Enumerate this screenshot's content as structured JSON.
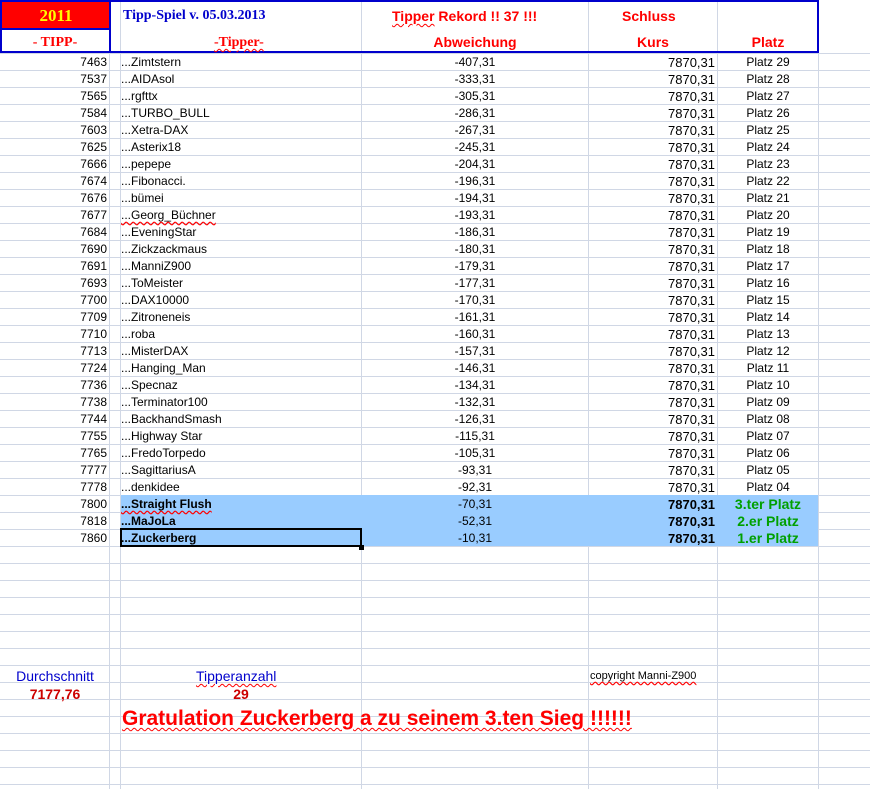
{
  "header": {
    "year": "2011",
    "spiel_label": "Tipp-Spiel v. 05.03.2013",
    "rekord_prefix": "Tipper",
    "rekord_rest": " Rekord !!  37  !!!",
    "schluss": "Schluss",
    "col_tipp": "- TIPP-",
    "col_tipper": "-Tipper-",
    "col_abweichung": "Abweichung",
    "col_kurs": "Kurs",
    "col_platz": "Platz"
  },
  "rows": [
    {
      "tipp": "7463",
      "name": "...Zimtstern",
      "abw": "-407,31",
      "kurs": "7870,31",
      "platz": "Platz 29"
    },
    {
      "tipp": "7537",
      "name": "...AIDAsol",
      "abw": "-333,31",
      "kurs": "7870,31",
      "platz": "Platz 28"
    },
    {
      "tipp": "7565",
      "name": "...rgfttx",
      "abw": "-305,31",
      "kurs": "7870,31",
      "platz": "Platz 27"
    },
    {
      "tipp": "7584",
      "name": "...TURBO_BULL",
      "abw": "-286,31",
      "kurs": "7870,31",
      "platz": "Platz 26"
    },
    {
      "tipp": "7603",
      "name": "...Xetra-DAX",
      "abw": "-267,31",
      "kurs": "7870,31",
      "platz": "Platz 25"
    },
    {
      "tipp": "7625",
      "name": "...Asterix18",
      "abw": "-245,31",
      "kurs": "7870,31",
      "platz": "Platz 24"
    },
    {
      "tipp": "7666",
      "name": "...pepepe",
      "abw": "-204,31",
      "kurs": "7870,31",
      "platz": "Platz 23"
    },
    {
      "tipp": "7674",
      "name": "...Fibonacci.",
      "abw": "-196,31",
      "kurs": "7870,31",
      "platz": "Platz 22"
    },
    {
      "tipp": "7676",
      "name": "...bümei",
      "abw": "-194,31",
      "kurs": "7870,31",
      "platz": "Platz 21"
    },
    {
      "tipp": "7677",
      "name": "...Georg_Büchner",
      "abw": "-193,31",
      "kurs": "7870,31",
      "platz": "Platz 20"
    },
    {
      "tipp": "7684",
      "name": "...EveningStar",
      "abw": "-186,31",
      "kurs": "7870,31",
      "platz": "Platz 19"
    },
    {
      "tipp": "7690",
      "name": "...Zickzackmaus",
      "abw": "-180,31",
      "kurs": "7870,31",
      "platz": "Platz 18"
    },
    {
      "tipp": "7691",
      "name": "...ManniZ900",
      "abw": "-179,31",
      "kurs": "7870,31",
      "platz": "Platz 17"
    },
    {
      "tipp": "7693",
      "name": "...ToMeister",
      "abw": "-177,31",
      "kurs": "7870,31",
      "platz": "Platz 16"
    },
    {
      "tipp": "7700",
      "name": "...DAX10000",
      "abw": "-170,31",
      "kurs": "7870,31",
      "platz": "Platz 15"
    },
    {
      "tipp": "7709",
      "name": "...Zitroneneis",
      "abw": "-161,31",
      "kurs": "7870,31",
      "platz": "Platz 14"
    },
    {
      "tipp": "7710",
      "name": "...roba",
      "abw": "-160,31",
      "kurs": "7870,31",
      "platz": "Platz 13"
    },
    {
      "tipp": "7713",
      "name": "...MisterDAX",
      "abw": "-157,31",
      "kurs": "7870,31",
      "platz": "Platz 12"
    },
    {
      "tipp": "7724",
      "name": "...Hanging_Man",
      "abw": "-146,31",
      "kurs": "7870,31",
      "platz": "Platz 11"
    },
    {
      "tipp": "7736",
      "name": "...Specnaz",
      "abw": "-134,31",
      "kurs": "7870,31",
      "platz": "Platz 10"
    },
    {
      "tipp": "7738",
      "name": "...Terminator100",
      "abw": "-132,31",
      "kurs": "7870,31",
      "platz": "Platz 09"
    },
    {
      "tipp": "7744",
      "name": "...BackhandSmash",
      "abw": "-126,31",
      "kurs": "7870,31",
      "platz": "Platz 08"
    },
    {
      "tipp": "7755",
      "name": "...Highway Star",
      "abw": "-115,31",
      "kurs": "7870,31",
      "platz": "Platz 07"
    },
    {
      "tipp": "7765",
      "name": "...FredoTorpedo",
      "abw": "-105,31",
      "kurs": "7870,31",
      "platz": "Platz 06"
    },
    {
      "tipp": "7777",
      "name": "...SagittariusA",
      "abw": "-93,31",
      "kurs": "7870,31",
      "platz": "Platz 05"
    },
    {
      "tipp": "7778",
      "name": "...denkidee",
      "abw": "-92,31",
      "kurs": "7870,31",
      "platz": "Platz 04"
    },
    {
      "tipp": "7800",
      "name": "...Straight Flush",
      "abw": "-70,31",
      "kurs": "7870,31",
      "platz": "3.ter Platz"
    },
    {
      "tipp": "7818",
      "name": "...MaJoLa",
      "abw": "-52,31",
      "kurs": "7870,31",
      "platz": "2.er Platz"
    },
    {
      "tipp": "7860",
      "name": "...Zuckerberg",
      "abw": "-10,31",
      "kurs": "7870,31",
      "platz": "1.er Platz"
    }
  ],
  "footer": {
    "durchschnitt_label": "Durchschnitt",
    "durchschnitt_value": "7177,76",
    "tipperanzahl_label": "Tipperanzahl",
    "tipperanzahl_value": "29",
    "copyright": "copyright Manni-Z900",
    "gratulation": "Gratulation Zuckerberg a  zu seinem 3.ten Sieg !!!!!!"
  },
  "colors": {
    "header_red_bg": "#ff0000",
    "header_year_text": "#ffff00",
    "header_border": "#0000cc",
    "highlight_bg": "#99ccff",
    "winner_green": "#00a000",
    "title_red": "#ff0000",
    "footer_blue": "#0000cc",
    "gridline": "#d0d7e5"
  }
}
